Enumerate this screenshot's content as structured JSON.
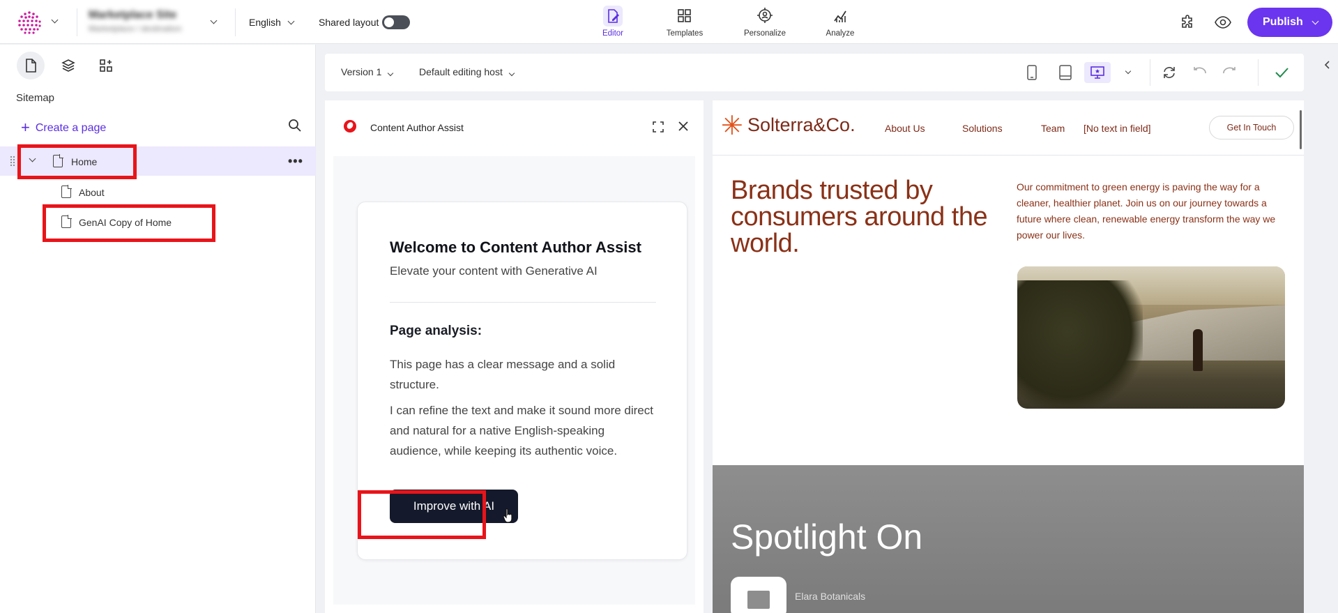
{
  "topbar": {
    "site_name": "Marketplace Site",
    "site_path": "Marketplace / destination",
    "language": "English",
    "shared_layout_label": "Shared layout",
    "shared_layout_on": false,
    "nav": [
      {
        "label": "Editor",
        "icon": "editor-icon",
        "active": true
      },
      {
        "label": "Templates",
        "icon": "templates-icon",
        "active": false
      },
      {
        "label": "Personalize",
        "icon": "personalize-icon",
        "active": false
      },
      {
        "label": "Analyze",
        "icon": "analyze-icon",
        "active": false
      }
    ],
    "publish_label": "Publish"
  },
  "sidebar": {
    "title": "Sitemap",
    "create_page_label": "Create a page",
    "tree": [
      {
        "label": "Home",
        "selected": true
      },
      {
        "label": "About",
        "selected": false
      },
      {
        "label": "GenAI Copy of Home",
        "selected": false
      }
    ]
  },
  "editor_toolbar": {
    "version": "Version 1",
    "editing_host": "Default editing host"
  },
  "assist": {
    "title": "Content Author Assist",
    "card_title": "Welcome to Content Author Assist",
    "card_subtitle": "Elevate your content with Generative AI",
    "analysis_heading": "Page analysis:",
    "analysis_p1": "This page has a clear message and a solid structure.",
    "analysis_p2": "I can refine the text and make it sound more direct and natural for a native English-speaking audience, while keeping its authentic voice.",
    "button_label": "Improve with AI"
  },
  "preview": {
    "brand": "Solterra&Co.",
    "nav": [
      "About Us",
      "Solutions",
      "Team",
      "[No text in field]"
    ],
    "cta": "Get In Touch",
    "hero_title": "Brands trusted by consumers around the world.",
    "hero_text": "Our commitment to green energy is paving the way for a cleaner, healthier planet. Join us on our journey towards a future where clean, renewable energy transform the way we power our lives.",
    "spotlight_title": "Spotlight On",
    "spotlight_item": "Elara Botanicals"
  },
  "colors": {
    "accent": "#6b35f0",
    "highlight": "#e8141a",
    "brand_text": "#8a3117"
  }
}
